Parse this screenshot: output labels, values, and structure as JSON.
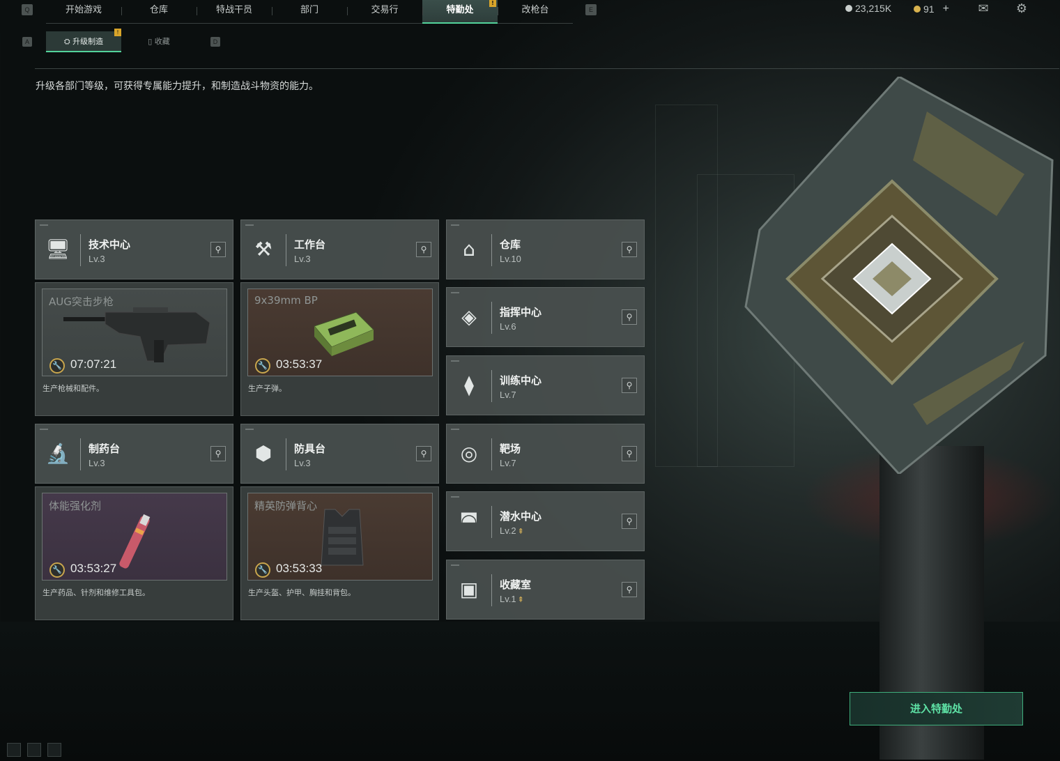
{
  "topnav": {
    "left_key": "Q",
    "right_key": "E",
    "tabs": [
      {
        "label": "开始游戏"
      },
      {
        "label": "仓库"
      },
      {
        "label": "特战干员"
      },
      {
        "label": "部门"
      },
      {
        "label": "交易行"
      },
      {
        "label": "特勤处",
        "active": true,
        "alert": "!"
      },
      {
        "label": "改枪台"
      }
    ],
    "currency_silver": "23,215K",
    "currency_gold": "91",
    "currency_add": "+"
  },
  "subtabs": {
    "left_key": "A",
    "right_key": "D",
    "items": [
      {
        "label": "升级制造",
        "active": true,
        "alert": "!"
      },
      {
        "label": "收藏"
      }
    ]
  },
  "description": "升级各部门等级，可获得专属能力提升，和制造战斗物资的能力。",
  "facilities": [
    {
      "name": "技术中心",
      "level": "Lv.3",
      "icon": "monitor-icon",
      "product": {
        "item": "AUG突击步枪",
        "timer": "07:07:21",
        "caption": "生产枪械和配件。",
        "tint": "gray"
      }
    },
    {
      "name": "工作台",
      "level": "Lv.3",
      "icon": "hammer-wrench-icon",
      "product": {
        "item": "9x39mm BP",
        "timer": "03:53:37",
        "caption": "生产子弹。",
        "tint": "brown"
      }
    },
    {
      "name": "制药台",
      "level": "Lv.3",
      "icon": "microscope-icon",
      "product": {
        "item": "体能强化剂",
        "timer": "03:53:27",
        "caption": "生产药品、针剂和维修工具包。",
        "tint": "purple"
      }
    },
    {
      "name": "防具台",
      "level": "Lv.3",
      "icon": "cubes-icon",
      "product": {
        "item": "精英防弹背心",
        "timer": "03:53:33",
        "caption": "生产头盔、护甲、胸挂和背包。",
        "tint": "brown"
      }
    }
  ],
  "side_facilities": [
    {
      "name": "仓库",
      "level": "Lv.10",
      "icon": "vault-icon"
    },
    {
      "name": "指挥中心",
      "level": "Lv.6",
      "icon": "command-icon"
    },
    {
      "name": "训练中心",
      "level": "Lv.7",
      "icon": "dumbbell-icon"
    },
    {
      "name": "靶场",
      "level": "Lv.7",
      "icon": "target-icon"
    },
    {
      "name": "潜水中心",
      "level": "Lv.2",
      "icon": "diving-mask-icon",
      "upgradable": true
    },
    {
      "name": "收藏室",
      "level": "Lv.1",
      "icon": "collection-icon",
      "upgradable": true
    }
  ],
  "enter_button": "进入特勤处",
  "colors": {
    "accent": "#53d39b",
    "alert": "#d9a52a",
    "timer_ring": "#c9a64d"
  }
}
